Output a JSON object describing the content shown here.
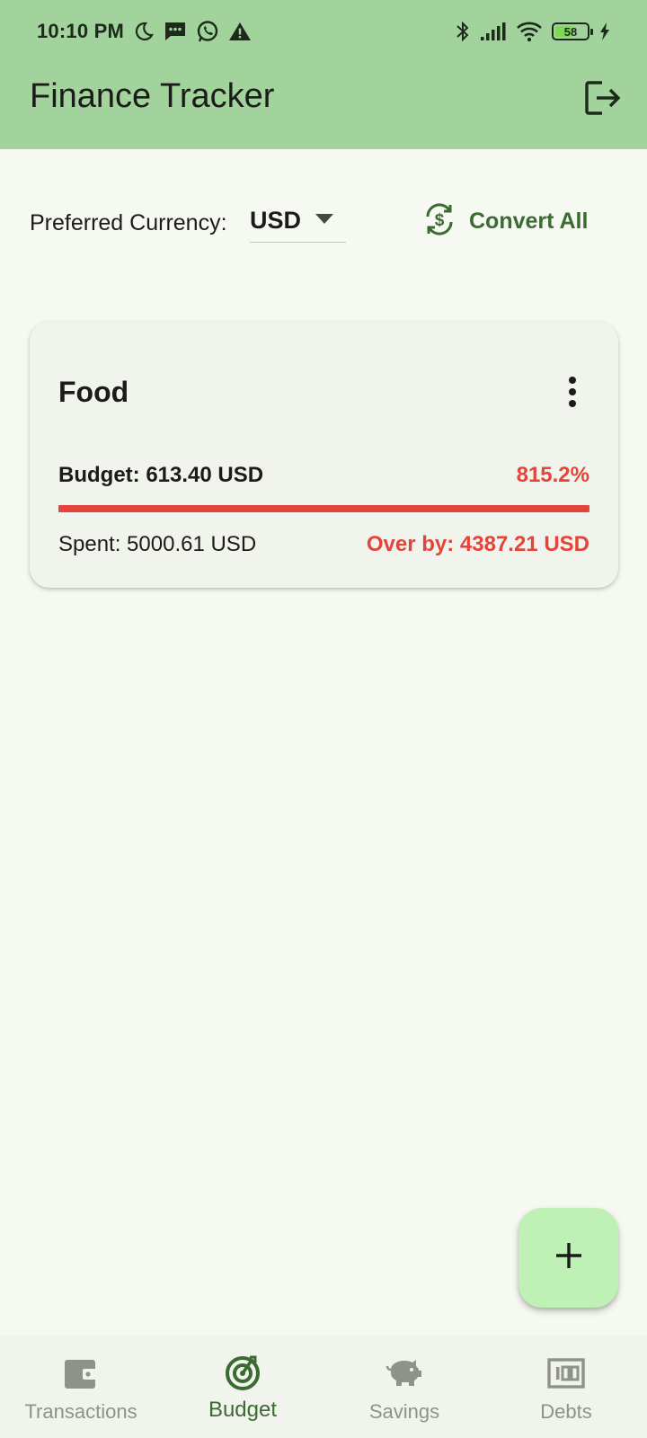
{
  "status_bar": {
    "time": "10:10 PM",
    "battery_percent": "58",
    "icons_left": [
      "moon-icon",
      "message-icon",
      "whatsapp-icon",
      "warning-icon"
    ],
    "icons_right": [
      "bluetooth-icon",
      "signal-icon",
      "wifi-icon",
      "battery-icon",
      "charging-icon"
    ]
  },
  "app_bar": {
    "title": "Finance Tracker",
    "logout_icon": "logout-icon"
  },
  "currency": {
    "label": "Preferred Currency:",
    "selected": "USD",
    "convert_label": "Convert All"
  },
  "budget_card": {
    "category": "Food",
    "budget_text": "Budget: 613.40 USD",
    "percent_text": "815.2%",
    "progress_fraction": 1.0,
    "spent_text": "Spent: 5000.61 USD",
    "over_text": "Over by: 4387.21 USD"
  },
  "fab": {
    "icon": "plus-icon"
  },
  "bottom_nav": {
    "items": [
      {
        "label": "Transactions",
        "icon": "wallet-icon",
        "active": false
      },
      {
        "label": "Budget",
        "icon": "target-icon",
        "active": true
      },
      {
        "label": "Savings",
        "icon": "piggy-bank-icon",
        "active": false
      },
      {
        "label": "Debts",
        "icon": "money-icon",
        "active": false
      }
    ]
  },
  "colors": {
    "app_bar": "#a2d39c",
    "background": "#f6f9f2",
    "accent": "#3c6a33",
    "danger": "#e5443a",
    "fab": "#bff0b6"
  }
}
